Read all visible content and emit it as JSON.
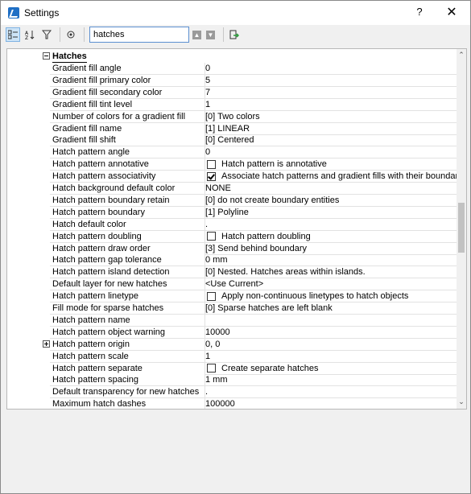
{
  "window": {
    "title": "Settings",
    "help": "?",
    "close": "✕"
  },
  "search": {
    "value": "hatches"
  },
  "category": {
    "label": "Hatches"
  },
  "rows": [
    {
      "name": "Gradient fill angle",
      "value": "0"
    },
    {
      "name": "Gradient fill primary color",
      "value": "5"
    },
    {
      "name": "Gradient fill secondary color",
      "value": "7"
    },
    {
      "name": "Gradient fill tint level",
      "value": "1"
    },
    {
      "name": "Number of colors for a gradient fill",
      "value": "[0] Two colors"
    },
    {
      "name": "Gradient fill name",
      "value": "[1] LINEAR"
    },
    {
      "name": "Gradient fill shift",
      "value": "[0] Centered"
    },
    {
      "name": "Hatch pattern angle",
      "value": "0"
    },
    {
      "name": "Hatch pattern annotative",
      "value": "Hatch pattern is annotative",
      "checkbox": true,
      "checked": false
    },
    {
      "name": "Hatch pattern associativity",
      "value": "Associate hatch patterns and gradient fills with their boundaries",
      "checkbox": true,
      "checked": true
    },
    {
      "name": "Hatch background default color",
      "value": "NONE"
    },
    {
      "name": "Hatch pattern boundary retain",
      "value": "[0] do not create boundary entities"
    },
    {
      "name": "Hatch pattern boundary",
      "value": "[1] Polyline"
    },
    {
      "name": "Hatch default color",
      "value": "."
    },
    {
      "name": "Hatch pattern doubling",
      "value": "Hatch pattern doubling",
      "checkbox": true,
      "checked": false
    },
    {
      "name": "Hatch pattern draw order",
      "value": "[3] Send behind boundary"
    },
    {
      "name": "Hatch pattern gap tolerance",
      "value": "0 mm"
    },
    {
      "name": "Hatch pattern island detection",
      "value": "[0] Nested. Hatches areas within islands."
    },
    {
      "name": "Default layer for new hatches",
      "value": "<Use Current>"
    },
    {
      "name": "Hatch pattern linetype",
      "value": "Apply non-continuous linetypes to hatch objects",
      "checkbox": true,
      "checked": false
    },
    {
      "name": "Fill mode for sparse hatches",
      "value": "[0] Sparse hatches are left blank"
    },
    {
      "name": "Hatch pattern name",
      "value": ""
    },
    {
      "name": "Hatch pattern object warning",
      "value": "10000"
    },
    {
      "name": "Hatch pattern origin",
      "value": "0, 0",
      "expandable": true
    },
    {
      "name": "Hatch pattern scale",
      "value": "1"
    },
    {
      "name": "Hatch pattern separate",
      "value": "Create separate hatches",
      "checkbox": true,
      "checked": false
    },
    {
      "name": "Hatch pattern spacing",
      "value": "1 mm"
    },
    {
      "name": "Default transparency for new hatches",
      "value": "."
    },
    {
      "name": "Maximum hatch dashes",
      "value": "100000"
    }
  ]
}
